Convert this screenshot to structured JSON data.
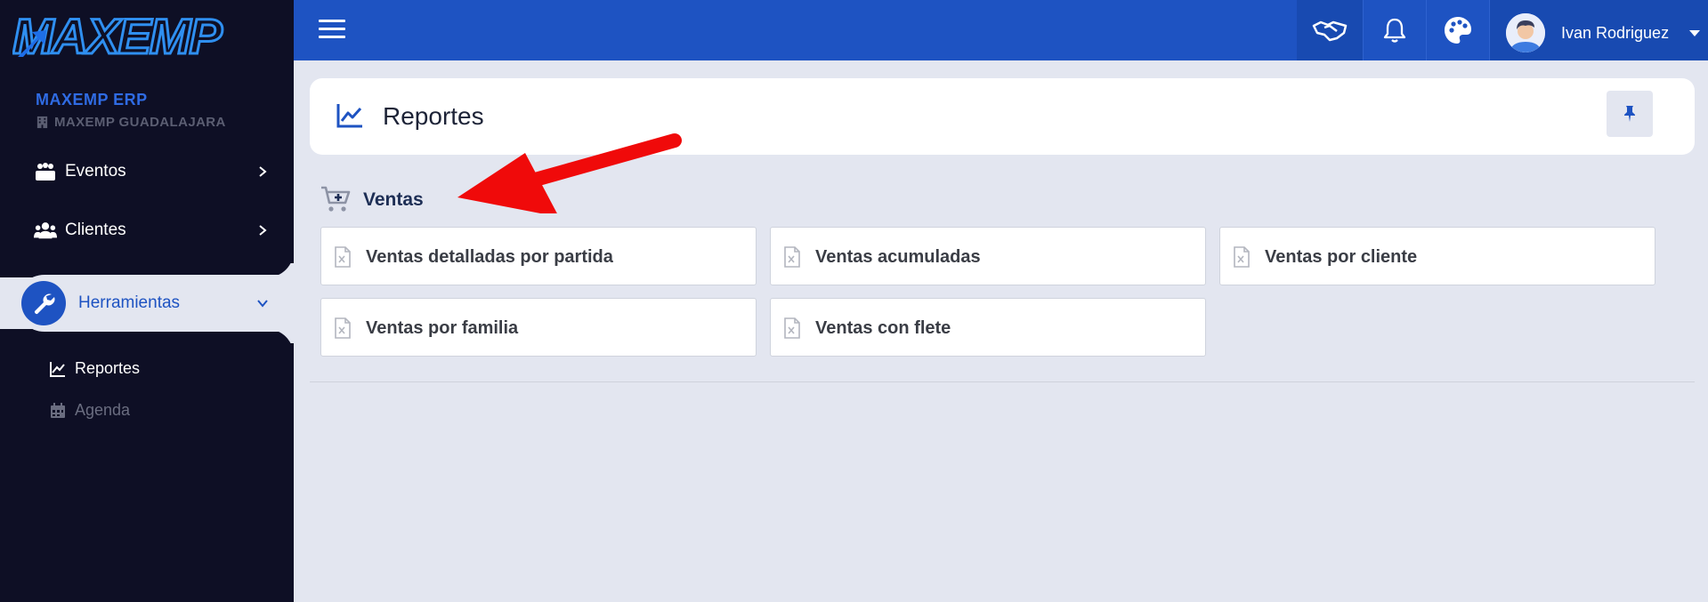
{
  "app": {
    "logo_text": "MAXEMP",
    "brand_color": "#1e53c2",
    "sidebar_color": "#0e0f25"
  },
  "sidebar": {
    "company_name": "MAXEMP ERP",
    "branch_name": "MAXEMP GUADALAJARA",
    "items": [
      {
        "label": "Eventos",
        "icon": "users-group-icon"
      },
      {
        "label": "Clientes",
        "icon": "users-icon"
      },
      {
        "label": "Herramientas",
        "icon": "wrench-icon",
        "active": true
      }
    ],
    "subitems": [
      {
        "label": "Reportes",
        "icon": "line-chart-icon",
        "active": true
      },
      {
        "label": "Agenda",
        "icon": "calendar-icon",
        "active": false
      }
    ]
  },
  "topbar": {
    "icons": [
      "menu-icon",
      "handshake-icon",
      "bell-icon",
      "palette-icon"
    ],
    "user_name": "Ivan Rodriguez"
  },
  "page": {
    "title": "Reportes"
  },
  "section": {
    "title": "Ventas",
    "reports": [
      "Ventas detalladas por partida",
      "Ventas acumuladas",
      "Ventas por cliente",
      "Ventas por familia",
      "Ventas con flete"
    ]
  },
  "annotation": {
    "arrow_color": "#f00a0a"
  }
}
